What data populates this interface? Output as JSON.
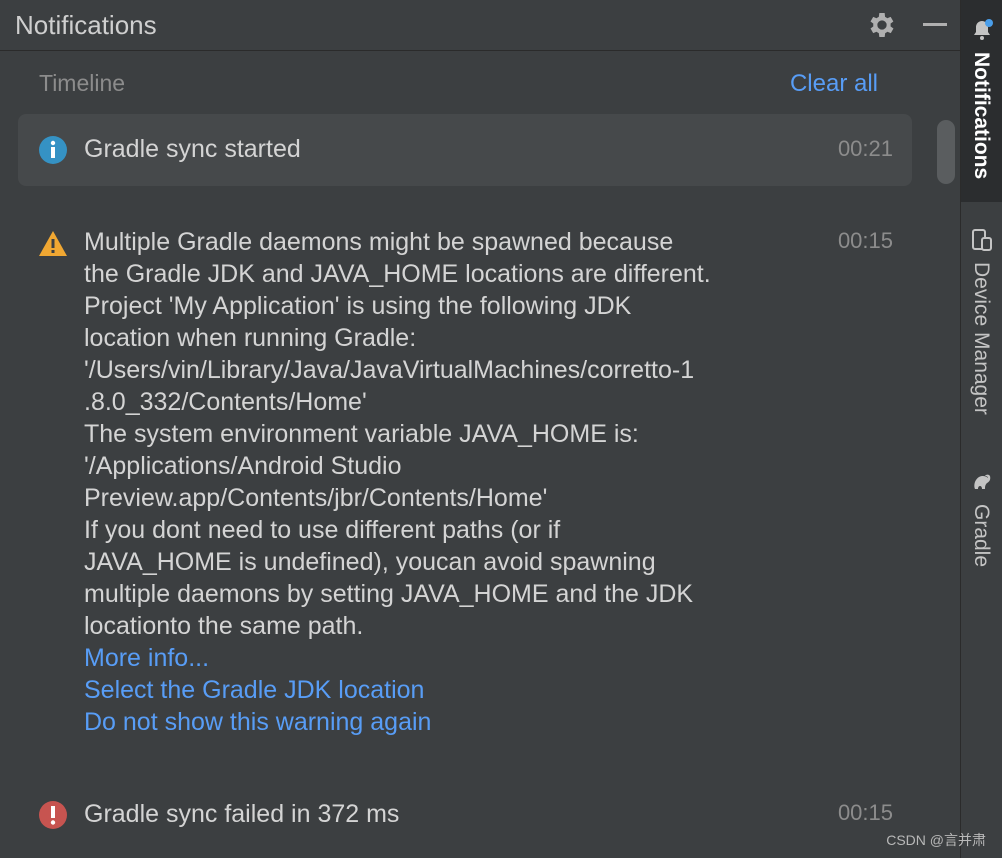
{
  "header": {
    "title": "Notifications"
  },
  "timeline": {
    "label": "Timeline",
    "clear_all": "Clear all"
  },
  "notifications": [
    {
      "type": "info",
      "icon": "info-icon",
      "message": "Gradle sync started",
      "time": "00:21"
    },
    {
      "type": "warning",
      "icon": "warning-icon",
      "lines": [
        "Multiple Gradle daemons might be spawned because",
        "the Gradle JDK and JAVA_HOME locations are different.",
        "Project 'My Application' is using the following JDK",
        "location when running Gradle:",
        "'/Users/vin/Library/Java/JavaVirtualMachines/corretto-1",
        ".8.0_332/Contents/Home'",
        "The system environment variable JAVA_HOME is:",
        "'/Applications/Android Studio",
        "Preview.app/Contents/jbr/Contents/Home'",
        "If you dont need to use different paths (or if",
        "JAVA_HOME is undefined), youcan avoid spawning",
        "multiple daemons by setting JAVA_HOME and the JDK",
        "locationto the same path."
      ],
      "links": {
        "more_info": "More info...",
        "select_jdk": "Select the Gradle JDK location",
        "do_not_show": "Do not show this warning again"
      },
      "time": "00:15"
    },
    {
      "type": "error",
      "icon": "error-icon",
      "message": "Gradle sync failed in 372 ms",
      "time": "00:15"
    }
  ],
  "right_toolbar": {
    "tabs": [
      {
        "label": "Notifications",
        "icon": "bell-icon",
        "active": true
      },
      {
        "label": "Device Manager",
        "icon": "device-manager-icon",
        "active": false
      },
      {
        "label": "Gradle",
        "icon": "gradle-icon",
        "active": false
      }
    ]
  },
  "watermark": "CSDN @言并肃",
  "colors": {
    "link": "#589df6",
    "info": "#3592c4",
    "warning": "#f0a732",
    "error": "#c75450",
    "badge": "#4a9eea"
  }
}
